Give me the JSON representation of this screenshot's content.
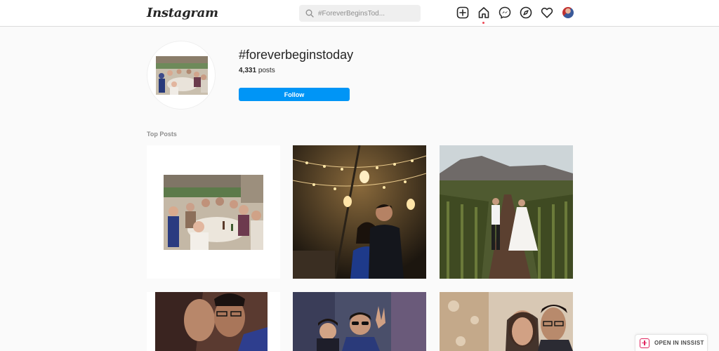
{
  "header": {
    "logo": "Instagram",
    "search_placeholder": "#ForeverBeginsTod..."
  },
  "icons": {
    "new_post": "plus-square-icon",
    "home": "home-icon",
    "messenger": "messenger-icon",
    "explore": "compass-icon",
    "activity": "heart-icon",
    "profile": "avatar"
  },
  "hashtag": {
    "title": "#foreverbeginstoday",
    "posts_count": "4,331",
    "posts_label": "posts",
    "follow_label": "Follow"
  },
  "section": {
    "top_posts": "Top Posts"
  },
  "overlay": {
    "open_in_inssist": "OPEN IN INSSIST"
  },
  "colors": {
    "accent": "#0095f6",
    "notification": "#ed4956",
    "inssist": "#e0245e"
  }
}
